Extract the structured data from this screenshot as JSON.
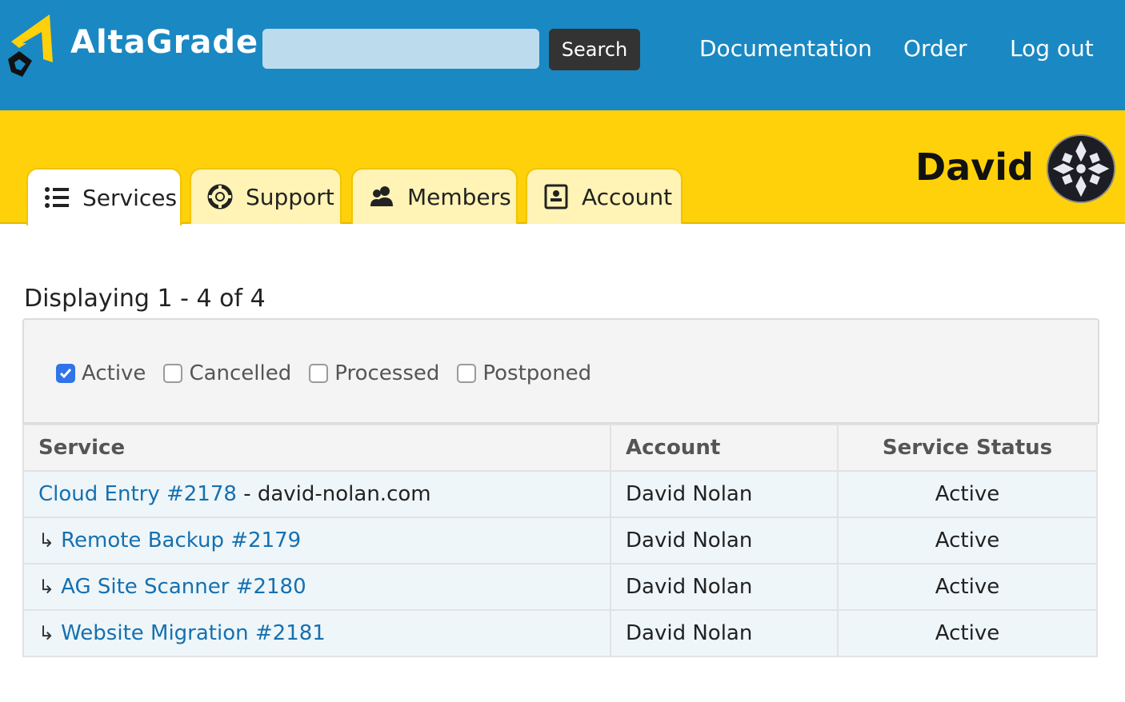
{
  "brand": {
    "name": "AltaGrade"
  },
  "search": {
    "placeholder": "",
    "button_label": "Search"
  },
  "nav": {
    "documentation": "Documentation",
    "order": "Order",
    "logout": "Log out"
  },
  "tabs": [
    {
      "label": "Services",
      "icon": "list-icon",
      "active": true
    },
    {
      "label": "Support",
      "icon": "lifebuoy-icon",
      "active": false
    },
    {
      "label": "Members",
      "icon": "users-icon",
      "active": false
    },
    {
      "label": "Account",
      "icon": "contact-card-icon",
      "active": false
    }
  ],
  "user": {
    "name": "David"
  },
  "listing": {
    "displaying": "Displaying 1 - 4 of 4"
  },
  "filters": [
    {
      "label": "Active",
      "checked": true
    },
    {
      "label": "Cancelled",
      "checked": false
    },
    {
      "label": "Processed",
      "checked": false
    },
    {
      "label": "Postponed",
      "checked": false
    }
  ],
  "table": {
    "headers": [
      "Service",
      "Account",
      "Service Status"
    ],
    "rows": [
      {
        "service": "Cloud Entry #2178",
        "domain": " - david-nolan.com",
        "child": false,
        "account": "David Nolan",
        "status": "Active"
      },
      {
        "service": "Remote Backup #2179",
        "domain": "",
        "child": true,
        "account": "David Nolan",
        "status": "Active"
      },
      {
        "service": "AG Site Scanner #2180",
        "domain": "",
        "child": true,
        "account": "David Nolan",
        "status": "Active"
      },
      {
        "service": "Website Migration #2181",
        "domain": "",
        "child": true,
        "account": "David Nolan",
        "status": "Active"
      }
    ]
  },
  "child_arrow": "↳",
  "colors": {
    "header_blue": "#1a88c2",
    "band_yellow": "#ffd10a",
    "link_blue": "#1670b0",
    "checkbox_blue": "#2f74e8"
  }
}
